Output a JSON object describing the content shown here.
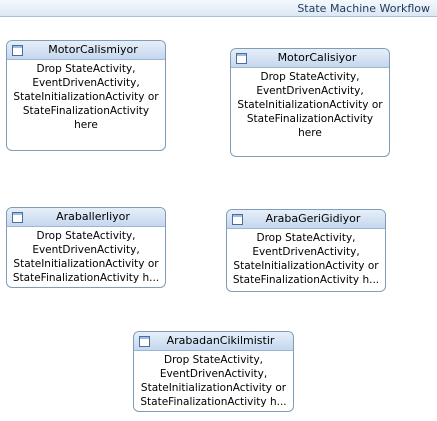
{
  "workflow": {
    "title": "State Machine Workflow"
  },
  "states": [
    {
      "name": "MotorCalismiyor",
      "body_lines": [
        "Drop StateActivity,",
        "EventDrivenActivity,",
        "StateInitializationActivity or",
        "StateFinalizationActivity",
        "here"
      ]
    },
    {
      "name": "MotorCalisiyor",
      "body_lines": [
        "Drop StateActivity,",
        "EventDrivenActivity,",
        "StateInitializationActivity or",
        "StateFinalizationActivity",
        "here"
      ]
    },
    {
      "name": "Araballerliyor",
      "body_lines": [
        "Drop StateActivity,",
        "EventDrivenActivity,",
        "StateInitializationActivity or",
        "StateFinalizationActivity h..."
      ]
    },
    {
      "name": "ArabaGeriGidiyor",
      "body_lines": [
        "Drop StateActivity,",
        "EventDrivenActivity,",
        "StateInitializationActivity or",
        "StateFinalizationActivity h..."
      ]
    },
    {
      "name": "ArabadanCikilmistir",
      "body_lines": [
        "Drop StateActivity,",
        "EventDrivenActivity,",
        "StateInitializationActivity or",
        "StateFinalizationActivity h..."
      ]
    }
  ]
}
